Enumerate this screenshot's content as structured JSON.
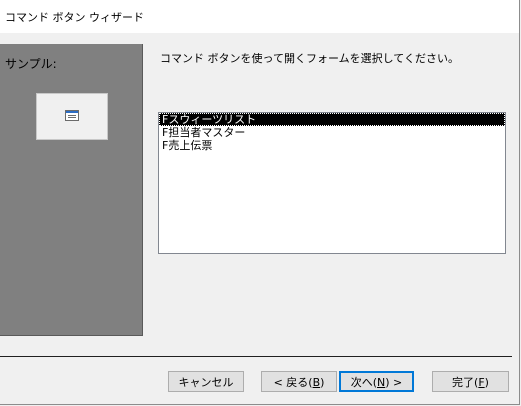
{
  "window": {
    "title": "コマンド ボタン ウィザード"
  },
  "sample": {
    "label": "サンプル:",
    "preview_icon": "form-icon"
  },
  "instruction": "コマンド ボタンを使って開くフォームを選択してください。",
  "forms_list": {
    "items": [
      "Fスウィーツリスト",
      "F担当者マスター",
      "F売上伝票"
    ],
    "selected_index": 0
  },
  "buttons": {
    "cancel": {
      "label": "キャンセル"
    },
    "back": {
      "prefix": "< 戻る(",
      "mnemonic": "B",
      "suffix": ")"
    },
    "next": {
      "prefix": "次へ(",
      "mnemonic": "N",
      "suffix": ") >"
    },
    "finish": {
      "prefix": "完了(",
      "mnemonic": "F",
      "suffix": ")"
    }
  },
  "colors": {
    "panel_gray": "#808080",
    "selection": "#000000",
    "default_button_border": "#0078d7"
  }
}
